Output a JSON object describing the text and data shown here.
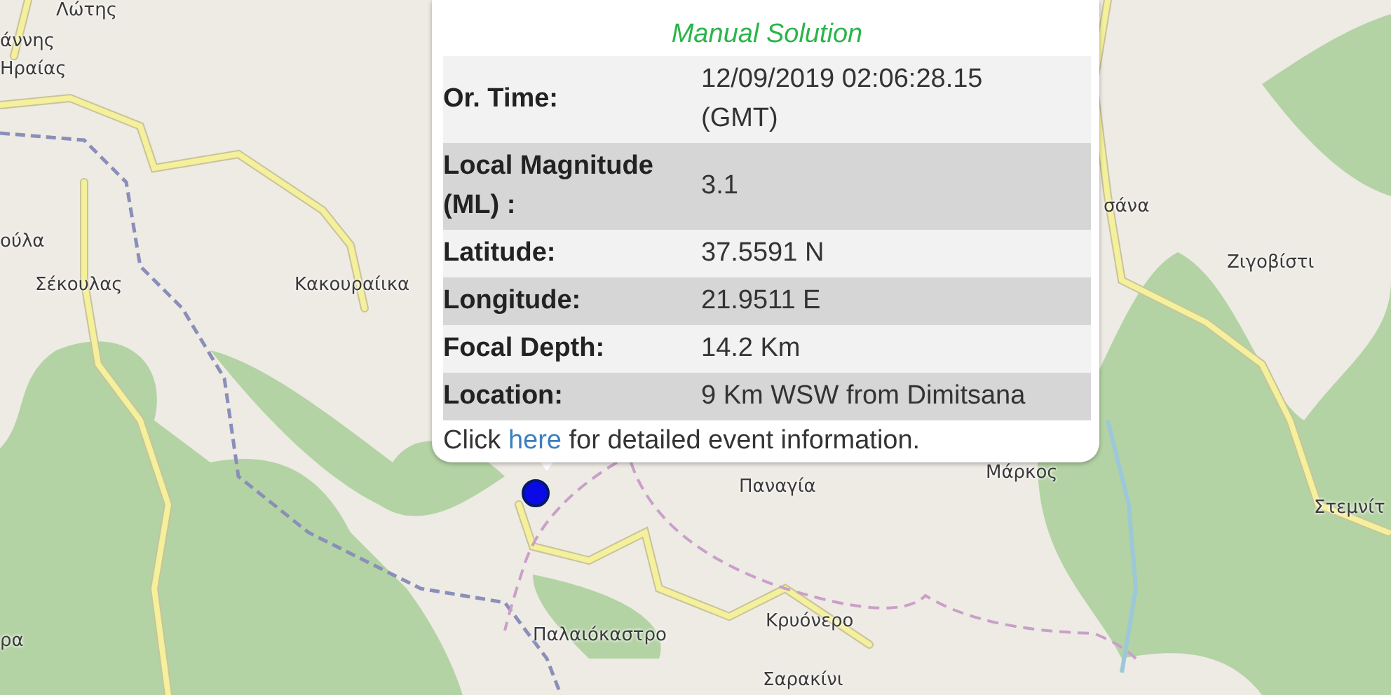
{
  "map": {
    "labels": [
      {
        "text": "Λώτης"
      },
      {
        "text": "άννης"
      },
      {
        "text": "Ηραίας"
      },
      {
        "text": "ούλα"
      },
      {
        "text": "Σέκουλας"
      },
      {
        "text": "Κακουραίικα"
      },
      {
        "text": "σάνα"
      },
      {
        "text": "Ζιγοβίστι"
      },
      {
        "text": "Παναγία"
      },
      {
        "text": "Μάρκος"
      },
      {
        "text": "Στεμνίτ"
      },
      {
        "text": "ρα"
      },
      {
        "text": "Παλαιόκαστρο"
      },
      {
        "text": "Κρυόνερο"
      },
      {
        "text": "Σαρακίνι"
      }
    ]
  },
  "popup": {
    "title": "Manual Solution",
    "rows": [
      {
        "label": "Or. Time:",
        "value": "12/09/2019 02:06:28.15 (GMT)"
      },
      {
        "label": "Local Magnitude (ML) :",
        "value": "3.1"
      },
      {
        "label": "Latitude:",
        "value": "37.5591 N"
      },
      {
        "label": "Longitude:",
        "value": "21.9511 E"
      },
      {
        "label": "Focal Depth:",
        "value": "14.2 Km"
      },
      {
        "label": "Location:",
        "value": "9 Km WSW from Dimitsana"
      }
    ],
    "footer": {
      "before": "Click ",
      "link": "here",
      "after": " for detailed event information."
    }
  }
}
